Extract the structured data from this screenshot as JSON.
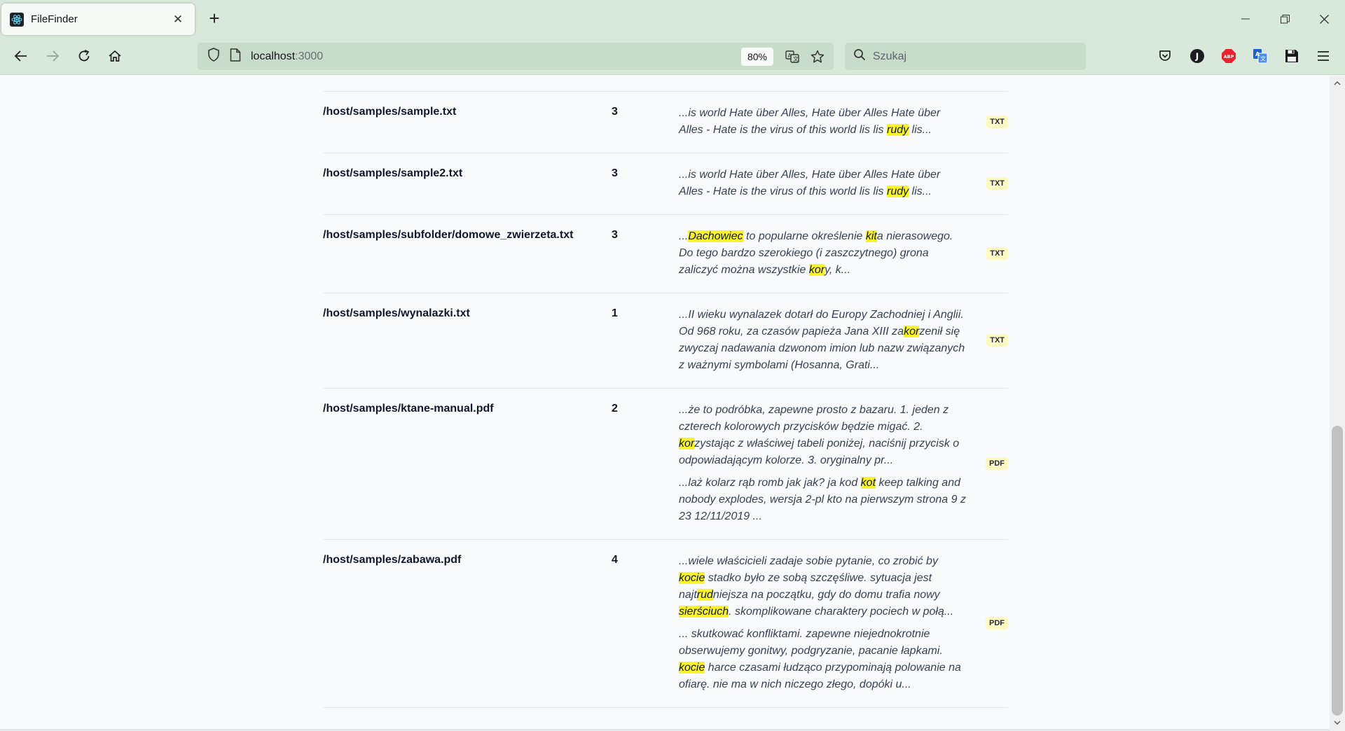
{
  "browser": {
    "tab_title": "FileFinder",
    "url_host": "localhost",
    "url_port": ":3000",
    "zoom": "80%",
    "search_placeholder": "Szukaj",
    "profile_initial": "J",
    "adblock_label": "ABP",
    "icons": [
      "react-favicon",
      "close-icon",
      "plus-icon",
      "minimize-icon",
      "restore-icon",
      "close-window-icon",
      "back-arrow-icon",
      "forward-arrow-icon",
      "reload-icon",
      "home-icon",
      "shield-icon",
      "page-icon",
      "translate-icon",
      "star-icon",
      "search-icon",
      "pocket-icon",
      "profile-icon",
      "adblock-icon",
      "translator-extension-icon",
      "save-icon",
      "menu-icon"
    ]
  },
  "results": [
    {
      "path": "/host/samples/sample.txt",
      "count": "3",
      "type": "TXT",
      "snippets": [
        [
          {
            "t": "...is world Hate über Alles, Hate über Alles Hate über Alles - Hate is the virus of this world lis lis "
          },
          {
            "t": "rudy",
            "h": true
          },
          {
            "t": " lis..."
          }
        ]
      ]
    },
    {
      "path": "/host/samples/sample2.txt",
      "count": "3",
      "type": "TXT",
      "snippets": [
        [
          {
            "t": "...is world Hate über Alles, Hate über Alles Hate über Alles - Hate is the virus of this world lis lis "
          },
          {
            "t": "rudy",
            "h": true
          },
          {
            "t": " lis..."
          }
        ]
      ]
    },
    {
      "path": "/host/samples/subfolder/domowe_zwierzeta.txt",
      "count": "3",
      "type": "TXT",
      "snippets": [
        [
          {
            "t": "..."
          },
          {
            "t": "Dachowiec",
            "h": true
          },
          {
            "t": " to popularne określenie "
          },
          {
            "t": "kit",
            "h": true
          },
          {
            "t": "a nierasowego. Do tego bardzo szerokiego (i zaszczytnego) grona zaliczyć można wszystkie "
          },
          {
            "t": "kor",
            "h": true
          },
          {
            "t": "y, k..."
          }
        ]
      ]
    },
    {
      "path": "/host/samples/wynalazki.txt",
      "count": "1",
      "type": "TXT",
      "snippets": [
        [
          {
            "t": "...II wieku wynalazek dotarł do Europy Zachodniej i Anglii. Od 968 roku, za czasów papieża Jana XIII za"
          },
          {
            "t": "kor",
            "h": true
          },
          {
            "t": "zenił się zwyczaj nadawania dzwonom imion lub nazw związanych z ważnymi symbolami (Hosanna, Grati..."
          }
        ]
      ]
    },
    {
      "path": "/host/samples/ktane-manual.pdf",
      "count": "2",
      "type": "PDF",
      "snippets": [
        [
          {
            "t": "...że to podróbka, zapewne prosto z bazaru. 1. jeden z czterech kolorowych przycisków będzie migać. 2. "
          },
          {
            "t": "kor",
            "h": true
          },
          {
            "t": "zystając z właściwej tabeli poniżej, naciśnij przycisk o odpowiadającym kolorze. 3. oryginalny pr..."
          }
        ],
        [
          {
            "t": "...laż kolarz rąb romb jak jak? ja kod "
          },
          {
            "t": "kot",
            "h": true
          },
          {
            "t": " keep talking and nobody explodes, wersja 2-pl kto na pierwszym strona 9 z 23 12/11/2019 ..."
          }
        ]
      ]
    },
    {
      "path": "/host/samples/zabawa.pdf",
      "count": "4",
      "type": "PDF",
      "snippets": [
        [
          {
            "t": "...wiele właścicieli zadaje sobie pytanie, co zrobić by "
          },
          {
            "t": "kocie",
            "h": true
          },
          {
            "t": " stadko było ze sobą szczęśliwe. sytuacja jest najt"
          },
          {
            "t": "rud",
            "h": true
          },
          {
            "t": "niejsza na początku, gdy do domu trafia nowy "
          },
          {
            "t": "sierściuch",
            "h": true
          },
          {
            "t": ". skomplikowane charaktery pociech w połą..."
          }
        ],
        [
          {
            "t": "... skutkować konfliktami. zapewne niejednokrotnie obserwujemy gonitwy, podgryzanie, pacanie łapkami. "
          },
          {
            "t": "kocie",
            "h": true
          },
          {
            "t": " harce czasami łudząco przypominają polowanie na ofiarę. nie ma w nich niczego złego, dopóki u..."
          }
        ]
      ]
    }
  ]
}
